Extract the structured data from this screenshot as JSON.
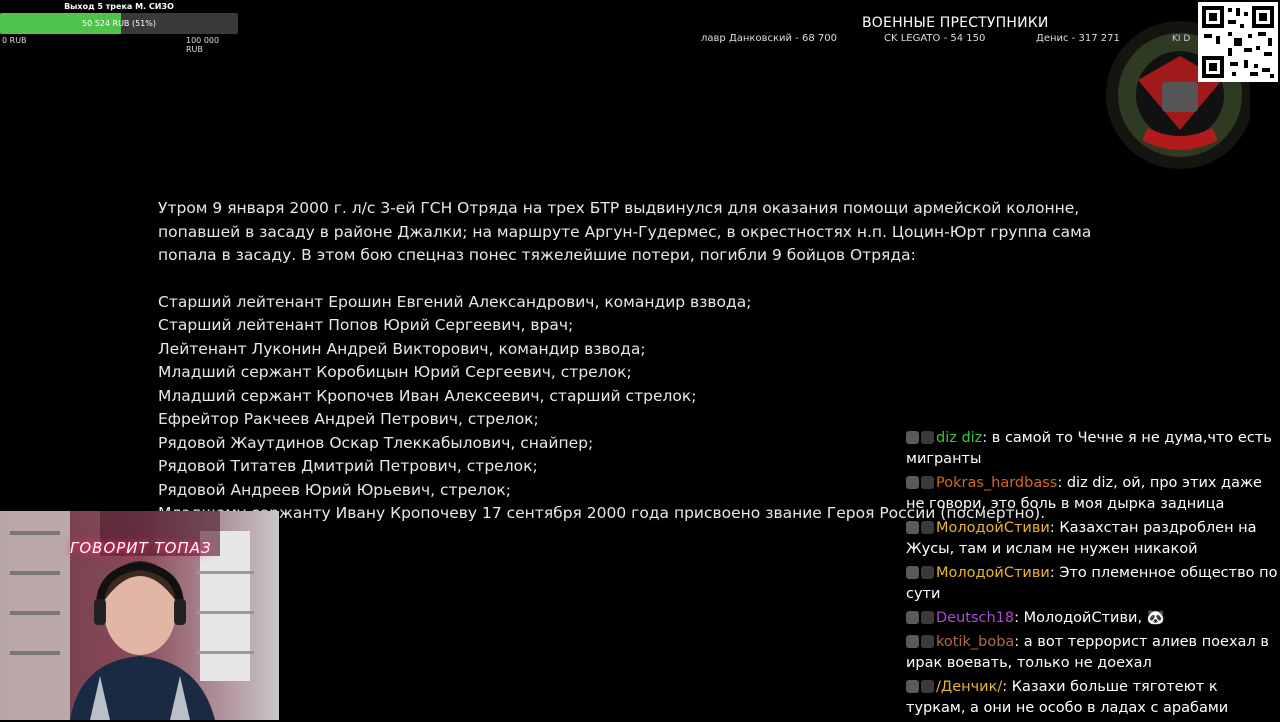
{
  "goal": {
    "title": "Выход 5 трека М. СИЗО",
    "progress_text": "50 524 RUB (51%)",
    "progress": 0.51,
    "min": "0 RUB",
    "max": "100 000 RUB",
    "fill_color": "#4fc44a"
  },
  "banner": {
    "title": "ВОЕННЫЕ ПРЕСТУПНИКИ",
    "donors": [
      "лавр Данковский - 68 700",
      "CK LEGATO - 54 150",
      "Денис - 317 271"
    ]
  },
  "emblem": {
    "kid_label": "KI D",
    "icon": "unit-emblem-icon",
    "qr_icon": "qr-code-icon"
  },
  "main": {
    "intro": "Утром 9 января 2000 г. л/с 3-ей ГСН Отряда на трех БТР выдвинулся для оказания помощи армейской колонне, попавшей в засаду в районе Джалки; на маршруте Аргун-Гудермес, в окрестностях н.п. Цоцин-Юрт группа сама попала в засаду. В этом бою спецназ понес тяжелейшие потери, погибли 9 бойцов Отряда:",
    "names": [
      "Старший лейтенант Ерошин Евгений Александрович, командир взвода;",
      "Старший лейтенант Попов Юрий Сергеевич, врач;",
      "Лейтенант Луконин Андрей Викторович, командир взвода;",
      "Младший сержант Коробицын Юрий Сергеевич, стрелок;",
      "Младший сержант Кропочев Иван Алексеевич, старший стрелок;",
      "Ефрейтор Ракчеев Андрей Петрович, стрелок;",
      "Рядовой Жаутдинов Оскар Тлеккабылович, снайпер;",
      "Рядовой Титатев Дмитрий Петрович, стрелок;",
      "Рядовой Андреев Юрий Юрьевич, стрелок;",
      "Младшему сержанту Ивану Кропочеву 17 сентября 2000 года присвоено звание Героя России (посмертно)."
    ]
  },
  "webcam": {
    "neon_sign": "ГОВОРИТ ТОПАЗ"
  },
  "chat": [
    {
      "nick": "diz diz",
      "color": "#3ec43e",
      "text": "в самой то Чечне я не дума,что есть мигранты"
    },
    {
      "nick": "Pokras_hardbass",
      "color": "#d2691e",
      "text": "diz diz, ой, про этих даже не говори, это боль в моя дырка задница"
    },
    {
      "nick": "МолодойСтиви",
      "color": "#e8b52e",
      "text": "Казахстан раздроблен на Жусы, там и ислам не нужен никакой"
    },
    {
      "nick": "МолодойСтиви",
      "color": "#e8b52e",
      "text": "Это племенное общество по сути"
    },
    {
      "nick": "Deutsch18",
      "color": "#b04bd8",
      "text": "МолодойСтиви, 🐼"
    },
    {
      "nick": "kotik_boba",
      "color": "#b5694f",
      "text": "а вот террорист алиев поехал в ирак воевать, только не доехал"
    },
    {
      "nick": "/Денчик/",
      "color": "#e8b52e",
      "text": "Казахи больше тяготеют к туркам, а они не особо в ладах с арабами"
    }
  ]
}
